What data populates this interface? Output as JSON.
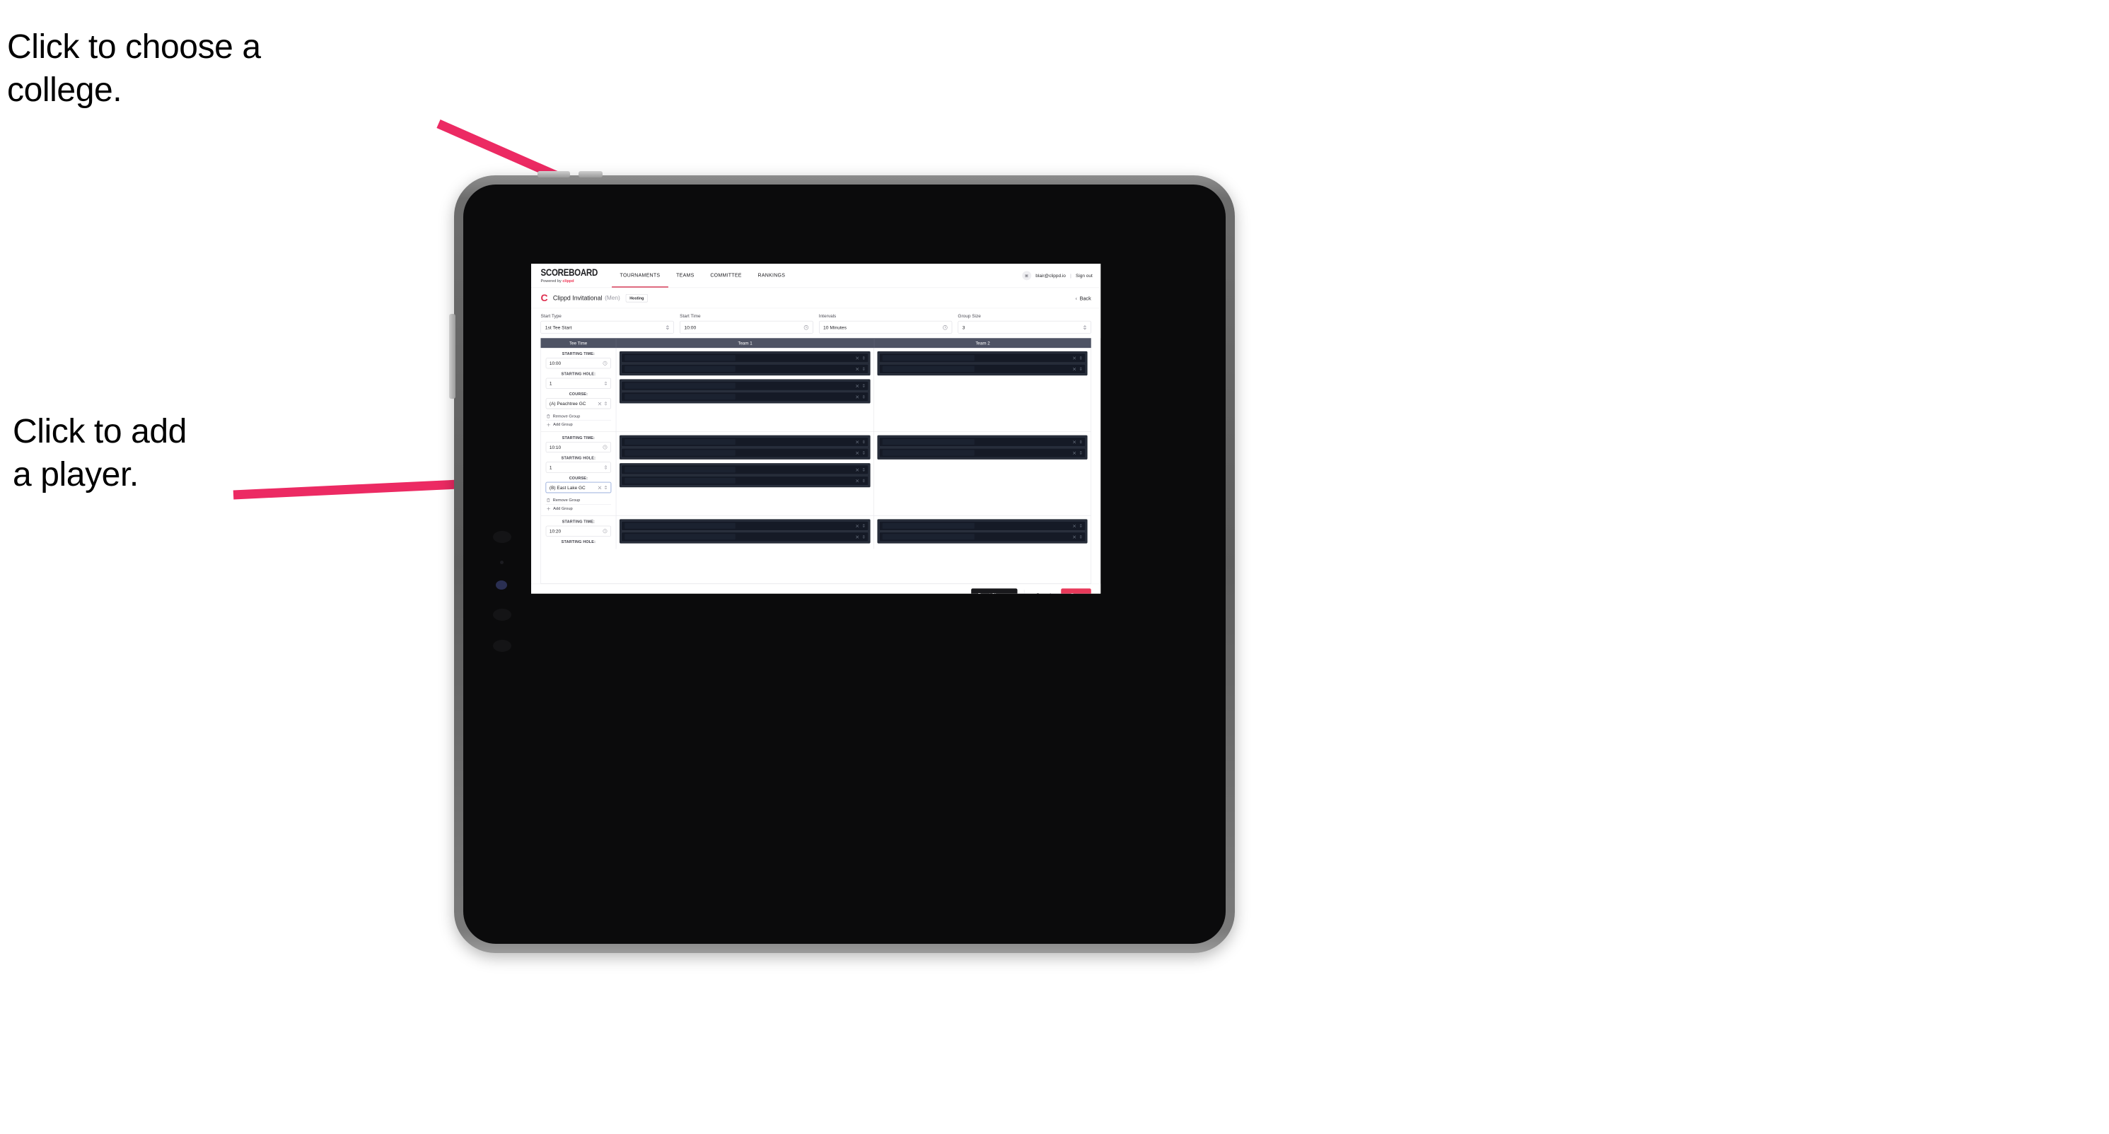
{
  "annotations": {
    "choose_college": "Click to choose a\ncollege.",
    "add_player": "Click to add\na player.",
    "arrow_color": "#ec2a63"
  },
  "app": {
    "brand": {
      "word": "SCOREBOARD",
      "powered_prefix": "Powered by ",
      "powered_brand": "clippd"
    },
    "nav": [
      {
        "label": "TOURNAMENTS",
        "active": true
      },
      {
        "label": "TEAMS",
        "active": false
      },
      {
        "label": "COMMITTEE",
        "active": false
      },
      {
        "label": "RANKINGS",
        "active": false
      }
    ],
    "account": {
      "avatar_glyph": "▣",
      "email": "blair@clippd.io",
      "separator": "|",
      "sign_out": "Sign out"
    },
    "title": {
      "logo_letter": "C",
      "tournament": "Clippd Invitational",
      "gender": "(Men)",
      "badge": "Hosting",
      "back": "Back",
      "back_chevron": "‹"
    },
    "filters": [
      {
        "label": "Start Type",
        "value": "1st Tee Start",
        "icon": "stepper-icon"
      },
      {
        "label": "Start Time",
        "value": "10:00",
        "icon": "clock-icon"
      },
      {
        "label": "Intervals",
        "value": "10 Minutes",
        "icon": "clock-icon"
      },
      {
        "label": "Group Size",
        "value": "3",
        "icon": "stepper-icon"
      }
    ],
    "table": {
      "headers": {
        "tee_time": "Tee Time",
        "team1": "Team 1",
        "team2": "Team 2"
      },
      "field_captions": {
        "time": "STARTING TIME:",
        "hole": "STARTING HOLE:",
        "course": "COURSE:"
      },
      "group_actions": {
        "remove": "Remove Group",
        "add": "Add Group"
      },
      "groups": [
        {
          "starting_time": "10:00",
          "starting_hole": "1",
          "course": "(A) Peachtree GC",
          "course_focused": false,
          "team1_slots": [
            {
              "rows": 2
            },
            {
              "rows": 2
            }
          ],
          "team2_slots": [
            {
              "rows": 2
            }
          ]
        },
        {
          "starting_time": "10:10",
          "starting_hole": "1",
          "course": "(B) East Lake GC",
          "course_focused": true,
          "team1_slots": [
            {
              "rows": 2
            },
            {
              "rows": 2
            }
          ],
          "team2_slots": [
            {
              "rows": 2
            }
          ]
        },
        {
          "starting_time": "10:20",
          "starting_hole": "",
          "course": "",
          "course_focused": false,
          "team1_slots": [
            {
              "rows": 2
            }
          ],
          "team2_slots": [
            {
              "rows": 2
            }
          ]
        }
      ]
    },
    "footer": {
      "reset": "Reset Changes",
      "cancel": "Cancel",
      "save": "Save",
      "save_color": "#e8395a"
    }
  }
}
